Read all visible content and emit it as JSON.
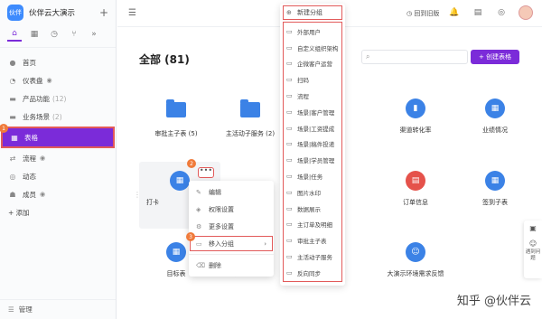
{
  "app": {
    "title": "伙伴云大演示",
    "logo_text": "伙伴"
  },
  "sidebar": {
    "tabs": [
      {
        "icon": "home-icon",
        "glyph": "⌂"
      },
      {
        "icon": "table-icon",
        "glyph": "▦"
      },
      {
        "icon": "clock-icon",
        "glyph": "◷"
      },
      {
        "icon": "branch-icon",
        "glyph": "⑂"
      },
      {
        "icon": "more-icon",
        "glyph": "»"
      }
    ],
    "items": [
      {
        "label": "首页",
        "count": "",
        "eye": false
      },
      {
        "label": "仪表盘",
        "count": "",
        "eye": true
      },
      {
        "label": "产品功能",
        "count": "(12)",
        "eye": false
      },
      {
        "label": "业务场景",
        "count": "(2)",
        "eye": false
      },
      {
        "label": "表格",
        "count": "",
        "eye": false,
        "badge": "1"
      },
      {
        "label": "流程",
        "count": "",
        "eye": true
      },
      {
        "label": "动态",
        "count": "",
        "eye": false
      },
      {
        "label": "成员",
        "count": "",
        "eye": true
      },
      {
        "label": "+ 添加",
        "count": "",
        "eye": false
      }
    ],
    "footer": "管理"
  },
  "topbar": {
    "back_old": "回到旧版"
  },
  "main": {
    "title": "全部 (81)",
    "search_placeholder": "",
    "create_button": "+ 创建表格",
    "tiles": [
      {
        "label": "审批主子表 (5)",
        "type": "folder"
      },
      {
        "label": "主活动子服务 (2)",
        "type": "folder"
      },
      {
        "label": "渠道转化率",
        "type": "chart"
      },
      {
        "label": "业绩情况",
        "type": "table"
      },
      {
        "label": "打卡",
        "type": "table"
      },
      {
        "label": "订单信息",
        "type": "red"
      },
      {
        "label": "签到子表",
        "type": "table"
      },
      {
        "label": "目标表",
        "type": "table"
      },
      {
        "label": "侧边栏查看联系",
        "type": "none"
      },
      {
        "label": "区",
        "type": "none"
      },
      {
        "label": "大演示环境需求反馈",
        "type": "smile"
      }
    ],
    "more_badge": "2",
    "more_glyph": "•••"
  },
  "context_menu": {
    "items": [
      {
        "label": "编辑",
        "icon": "pencil-icon",
        "glyph": "✎"
      },
      {
        "label": "权限设置",
        "icon": "shield-icon",
        "glyph": "◈"
      },
      {
        "label": "更多设置",
        "icon": "gear-icon",
        "glyph": "⚙"
      },
      {
        "label": "移入分组",
        "icon": "folder-move-icon",
        "glyph": "▭",
        "badge": "3"
      },
      {
        "label": "删除",
        "icon": "trash-icon",
        "glyph": "🗑"
      }
    ]
  },
  "submenu": {
    "new_group": "新建分组",
    "groups": [
      "外部用户",
      "自定义组织架构",
      "企微客户运营",
      "扫码",
      "流程",
      "场景|客户管理",
      "场景|工资提成",
      "场景|稿件投递",
      "场景|学员管理",
      "场景|任务",
      "图片水印",
      "数据展示",
      "主订单及明细",
      "审批主子表",
      "主活动子服务",
      "反向同步",
      "连接|天眼查"
    ]
  },
  "float": {
    "help_label": "遇到问题"
  },
  "watermark": "知乎 @伙伴云"
}
